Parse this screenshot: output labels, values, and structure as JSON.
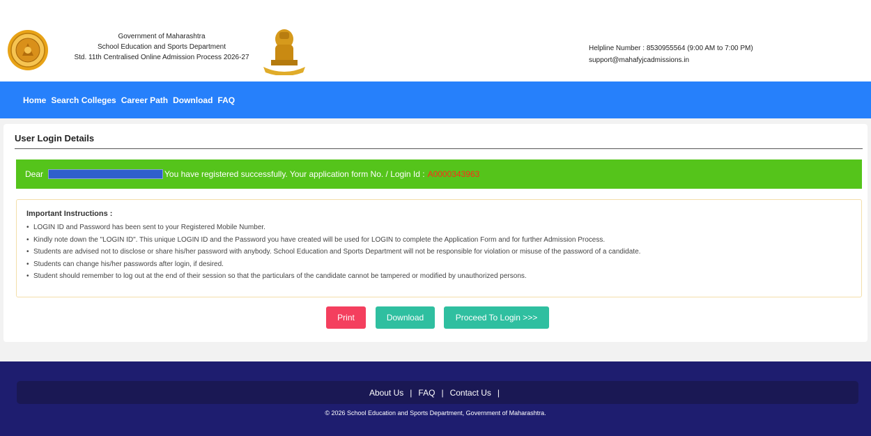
{
  "header": {
    "gov_line1": "Government of Maharashtra",
    "gov_line2": "School Education and Sports Department",
    "gov_line3": "Std. 11th Centralised Online Admission Process 2026-27",
    "helpline": "Helpline Number : 8530955564 (9:00 AM to 7:00 PM)",
    "email": "support@mahafyjcadmissions.in",
    "left_logo": "maharashtra-seal-icon",
    "right_logo": "national-emblem-icon"
  },
  "nav": {
    "items": [
      "Home",
      "Search Colleges",
      "Career Path",
      "Download",
      "FAQ"
    ]
  },
  "main": {
    "title": "User Login Details",
    "success": {
      "dear": "Dear",
      "message": "You have registered successfully. Your application form No. / Login Id :",
      "login_id": "A0000343963"
    },
    "instructions": {
      "heading": "Important Instructions :",
      "items": [
        "LOGIN ID and Password has been sent to your Registered Mobile Number.",
        "Kindly note down the \"LOGIN ID\". This unique LOGIN ID and the Password you have created will be used for LOGIN to complete the Application Form and for further Admission Process.",
        "Students are advised not to disclose or share his/her password with anybody. School Education and Sports Department will not be responsible for violation or misuse of the password of a candidate.",
        "Students can change his/her passwords after login, if desired.",
        "Student should remember to log out at the end of their session so that the particulars of the candidate cannot be tampered or modified by unauthorized persons."
      ]
    },
    "buttons": {
      "print": "Print",
      "download": "Download",
      "proceed": "Proceed To Login >>>"
    }
  },
  "footer": {
    "links": [
      "About Us",
      "FAQ",
      "Contact Us"
    ],
    "separator": "|",
    "copyright": "© 2026 School Education and Sports Department, Government of Maharashtra."
  },
  "colors": {
    "navbar": "#2680fb",
    "success": "#55c41b",
    "print_button": "#f43f5e",
    "teal_button": "#2fbfa0",
    "footer": "#1e1d6f",
    "login_id": "#ff2a1a"
  }
}
